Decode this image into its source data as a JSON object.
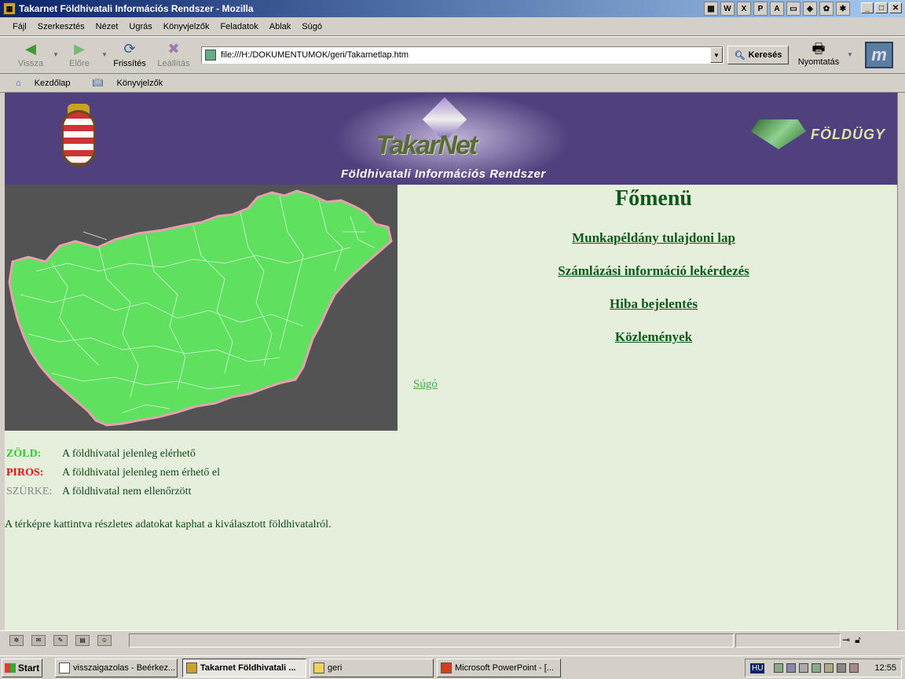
{
  "window": {
    "title": "Takarnet Földhivatali Információs Rendszer - Mozilla"
  },
  "menu": [
    "Fájl",
    "Szerkesztés",
    "Nézet",
    "Ugrás",
    "Könyvjelzők",
    "Feladatok",
    "Ablak",
    "Súgó"
  ],
  "toolbar": {
    "back": "Vissza",
    "forward": "Előre",
    "reload": "Frissítés",
    "stop": "Leállítás",
    "url": "file:///H:/DOKUMENTUMOK/geri/Takarnetlap.htm",
    "search": "Keresés",
    "print": "Nyomtatás"
  },
  "personal": {
    "home": "Kezdőlap",
    "bookmarks": "Könyvjelzők"
  },
  "banner": {
    "logo_text": "TakarNet",
    "subtitle": "Földhivatali Információs Rendszer",
    "partner": "FÖLDÜGY"
  },
  "main": {
    "title": "Főmenü",
    "links": [
      "Munkapéldány tulajdoni lap",
      "Számlázási információ lekérdezés",
      "Hiba bejelentés",
      "Közlemények"
    ],
    "help": "Súgó"
  },
  "legend": [
    {
      "key": "ZÖLD:",
      "desc": "A földhivatal jelenleg elérhető",
      "color": "#2ecc2e"
    },
    {
      "key": "PIROS:",
      "desc": "A földhivatal jelenleg nem érhető el",
      "color": "#e01010"
    },
    {
      "key": "SZÜRKE:",
      "desc": "A földhivatal nem ellenőrzött",
      "color": "#888888"
    }
  ],
  "note": "A térképre kattintva részletes adatokat kaphat a kiválasztott földhivatalról.",
  "taskbar": {
    "start": "Start",
    "tasks": [
      "visszaigazolas - Beérkez...",
      "Takarnet Földhivatali ...",
      "geri",
      "Microsoft PowerPoint - [..."
    ],
    "lang": "HU",
    "clock": "12:55"
  },
  "colors": {
    "banner_bg": "#51407e",
    "content_bg": "#e6efdc",
    "map_green": "#5fe05f",
    "map_bg": "#535353",
    "link_green": "#0b5a1a"
  }
}
